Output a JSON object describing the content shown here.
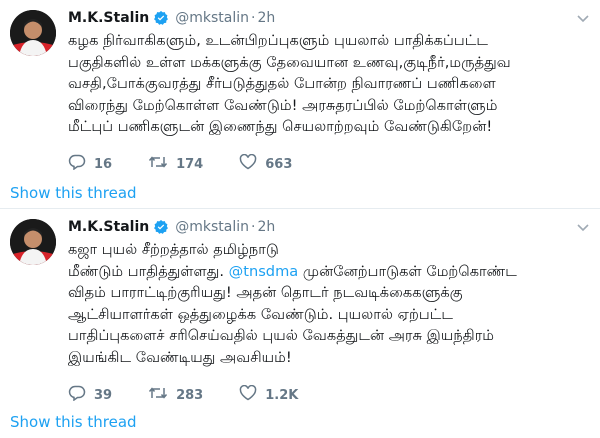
{
  "tweets": [
    {
      "name": "M.K.Stalin",
      "handle": "@mkstalin",
      "separator": "·",
      "time": "2h",
      "text": "கழக நிர்வாகிகளும், உடன்பிறப்புகளும் புயலால் பாதிக்கப்பட்ட\nபகுதிகளில் உள்ள மக்களுக்கு தேவையான உணவு,குடிநீர்,மருத்துவ\nவசதி,போக்குவரத்து சீர்படுத்துதல் போன்ற நிவாரணப் பணிகளை\nவிரைந்து மேற்கொள்ள வேண்டும்! அரசுதரப்பில் மேற்கொள்ளும்\nமீட்புப் பணிகளுடன் இணைந்து செயலாற்றவும் வேண்டுகிறேன்!",
      "replies": "16",
      "retweets": "174",
      "likes": "663",
      "show_thread": "Show this thread"
    },
    {
      "name": "M.K.Stalin",
      "handle": "@mkstalin",
      "separator": "·",
      "time": "2h",
      "text_before": "கஜா புயல் சீற்றத்தால் தமிழ்நாடு\nமீண்டும் பாதித்துள்ளது. ",
      "mention": "@tnsdma",
      "text_after": " முன்னேற்பாடுகள் மேற்கொண்ட\nவிதம் பாராட்டிற்குரியது! அதன் தொடர் நடவடிக்கைகளுக்கு\nஆட்சியாளர்கள் ஒத்துழைக்க வேண்டும். புயலால் ஏற்பட்ட\nபாதிப்புகளைச் சரிசெய்வதில் புயல் வேகத்துடன் அரசு இயந்திரம்\nஇயங்கிட வேண்டியது அவசியம்!",
      "replies": "39",
      "retweets": "283",
      "likes": "1.2K",
      "show_thread": "Show this thread"
    }
  ],
  "colors": {
    "link": "#1da1f2",
    "muted": "#657786",
    "border": "#e6ecf0",
    "avatar_accent": "#d8232a"
  },
  "icons": [
    "avatar",
    "verified-badge-icon",
    "chevron-down-icon",
    "reply-icon",
    "retweet-icon",
    "like-icon"
  ]
}
